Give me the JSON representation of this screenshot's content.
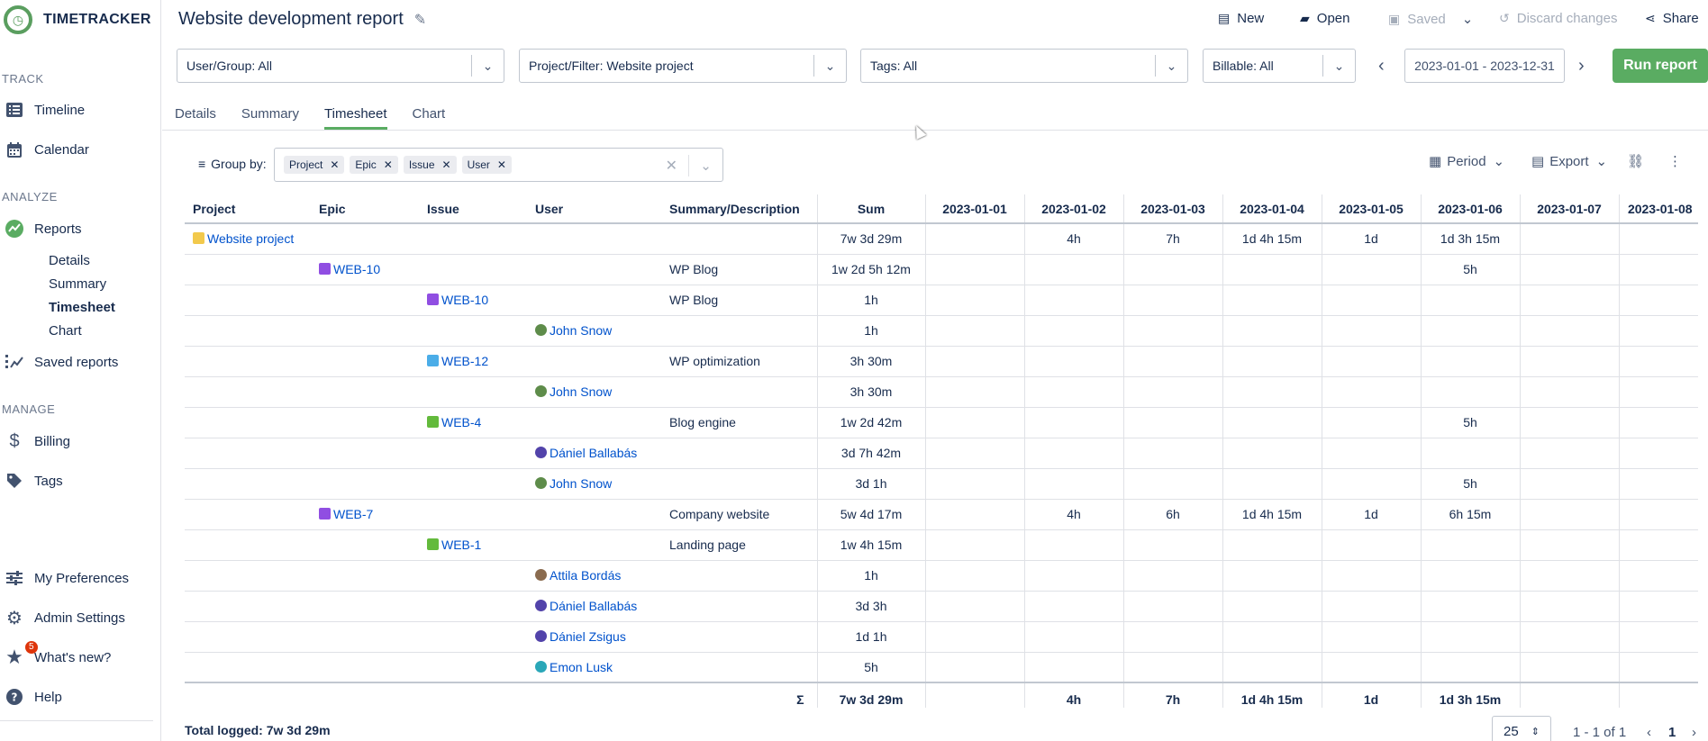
{
  "app": {
    "name": "TIMETRACKER",
    "logo_glyph": "◷"
  },
  "sidebar": {
    "track_label": "TRACK",
    "timeline": "Timeline",
    "calendar": "Calendar",
    "analyze_label": "ANALYZE",
    "reports": "Reports",
    "reports_sub": [
      "Details",
      "Summary",
      "Timesheet",
      "Chart"
    ],
    "saved_reports": "Saved reports",
    "manage_label": "MANAGE",
    "billing": "Billing",
    "tags": "Tags",
    "preferences": "My Preferences",
    "admin": "Admin Settings",
    "whats_new": "What's new?",
    "whats_new_badge": "5",
    "help": "Help"
  },
  "header": {
    "title": "Website development report",
    "new": "New",
    "open": "Open",
    "saved": "Saved",
    "discard": "Discard changes",
    "share": "Share"
  },
  "filters": {
    "user_group": "User/Group: All",
    "project": "Project/Filter: Website project",
    "tags": "Tags: All",
    "billable": "Billable: All",
    "date_range": "2023-01-01 - 2023-12-31",
    "run": "Run report"
  },
  "tabs": [
    "Details",
    "Summary",
    "Timesheet",
    "Chart"
  ],
  "active_tab": "Timesheet",
  "groupby": {
    "label": "Group by:",
    "chips": [
      "Project",
      "Epic",
      "Issue",
      "User"
    ]
  },
  "tools": {
    "period": "Period",
    "export": "Export"
  },
  "table": {
    "headers": [
      "Project",
      "Epic",
      "Issue",
      "User",
      "Summary/Description",
      "Sum",
      "2023-01-01",
      "2023-01-02",
      "2023-01-03",
      "2023-01-04",
      "2023-01-05",
      "2023-01-06",
      "2023-01-07",
      "2023-01-08"
    ],
    "rows": [
      {
        "project": "Website project",
        "epic": "",
        "issue": "",
        "user": "",
        "summary": "",
        "sum": "7w 3d 29m",
        "days": [
          "",
          "4h",
          "7h",
          "1d 4h 15m",
          "1d",
          "1d 3h 15m",
          "",
          ""
        ]
      },
      {
        "project": "",
        "epic": "WEB-10",
        "issue": "",
        "user": "",
        "summary": "WP Blog",
        "sum": "1w 2d 5h 12m",
        "days": [
          "",
          "",
          "",
          "",
          "",
          "5h",
          "",
          ""
        ]
      },
      {
        "project": "",
        "epic": "",
        "issue": "WEB-10",
        "issue_type": "epic",
        "user": "",
        "summary": "WP Blog",
        "sum": "1h",
        "days": [
          "",
          "",
          "",
          "",
          "",
          "",
          "",
          ""
        ]
      },
      {
        "project": "",
        "epic": "",
        "issue": "",
        "user": "John Snow",
        "avatar": "g",
        "summary": "",
        "sum": "1h",
        "days": [
          "",
          "",
          "",
          "",
          "",
          "",
          "",
          ""
        ]
      },
      {
        "project": "",
        "epic": "",
        "issue": "WEB-12",
        "issue_type": "task",
        "user": "",
        "summary": "WP optimization",
        "sum": "3h 30m",
        "days": [
          "",
          "",
          "",
          "",
          "",
          "",
          "",
          ""
        ]
      },
      {
        "project": "",
        "epic": "",
        "issue": "",
        "user": "John Snow",
        "avatar": "g",
        "summary": "",
        "sum": "3h 30m",
        "days": [
          "",
          "",
          "",
          "",
          "",
          "",
          "",
          ""
        ]
      },
      {
        "project": "",
        "epic": "",
        "issue": "WEB-4",
        "issue_type": "story",
        "user": "",
        "summary": "Blog engine",
        "sum": "1w 2d 42m",
        "days": [
          "",
          "",
          "",
          "",
          "",
          "5h",
          "",
          ""
        ]
      },
      {
        "project": "",
        "epic": "",
        "issue": "",
        "user": "Dániel Ballabás",
        "avatar": "p",
        "summary": "",
        "sum": "3d 7h 42m",
        "days": [
          "",
          "",
          "",
          "",
          "",
          "",
          "",
          ""
        ]
      },
      {
        "project": "",
        "epic": "",
        "issue": "",
        "user": "John Snow",
        "avatar": "g",
        "summary": "",
        "sum": "3d 1h",
        "days": [
          "",
          "",
          "",
          "",
          "",
          "5h",
          "",
          ""
        ]
      },
      {
        "project": "",
        "epic": "WEB-7",
        "issue": "",
        "user": "",
        "summary": "Company website",
        "sum": "5w 4d 17m",
        "days": [
          "",
          "4h",
          "6h",
          "1d 4h 15m",
          "1d",
          "6h 15m",
          "",
          ""
        ]
      },
      {
        "project": "",
        "epic": "",
        "issue": "WEB-1",
        "issue_type": "story",
        "user": "",
        "summary": "Landing page",
        "sum": "1w 4h 15m",
        "days": [
          "",
          "",
          "",
          "",
          "",
          "",
          "",
          ""
        ]
      },
      {
        "project": "",
        "epic": "",
        "issue": "",
        "user": "Attila Bordás",
        "avatar": "b",
        "summary": "",
        "sum": "1h",
        "days": [
          "",
          "",
          "",
          "",
          "",
          "",
          "",
          ""
        ]
      },
      {
        "project": "",
        "epic": "",
        "issue": "",
        "user": "Dániel Ballabás",
        "avatar": "p",
        "summary": "",
        "sum": "3d 3h",
        "days": [
          "",
          "",
          "",
          "",
          "",
          "",
          "",
          ""
        ]
      },
      {
        "project": "",
        "epic": "",
        "issue": "",
        "user": "Dániel Zsigus",
        "avatar": "p",
        "summary": "",
        "sum": "1d 1h",
        "days": [
          "",
          "",
          "",
          "",
          "",
          "",
          "",
          ""
        ]
      },
      {
        "project": "",
        "epic": "",
        "issue": "",
        "user": "Emon Lusk",
        "avatar": "t",
        "summary": "",
        "sum": "5h",
        "days": [
          "",
          "",
          "",
          "",
          "",
          "",
          "",
          ""
        ]
      }
    ],
    "footer": {
      "sigma": "Σ",
      "sum": "7w 3d 29m",
      "days": [
        "",
        "4h",
        "7h",
        "1d 4h 15m",
        "1d",
        "1d 3h 15m",
        "",
        ""
      ]
    }
  },
  "bottom": {
    "total": "Total logged: 7w 3d 29m",
    "page_size": "25",
    "range": "1 - 1 of 1",
    "page": "1"
  }
}
